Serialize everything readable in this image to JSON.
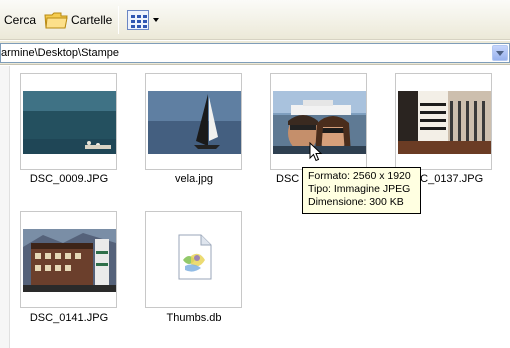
{
  "toolbar": {
    "search_label": "Cerca",
    "folders_label": "Cartelle",
    "views_icon": "views-icon"
  },
  "address": {
    "path": "armine\\Desktop\\Stampe"
  },
  "files": [
    {
      "name": "DSC_0009.JPG"
    },
    {
      "name": "vela.jpg"
    },
    {
      "name": "DSC"
    },
    {
      "name": "DSC_0137.JPG"
    },
    {
      "name": "DSC_0141.JPG"
    },
    {
      "name": "Thumbs.db"
    }
  ],
  "tooltip": {
    "line1": "Formato: 2560 x 1920",
    "line2": "Tipo: Immagine JPEG",
    "line3": "Dimensione: 300 KB"
  }
}
